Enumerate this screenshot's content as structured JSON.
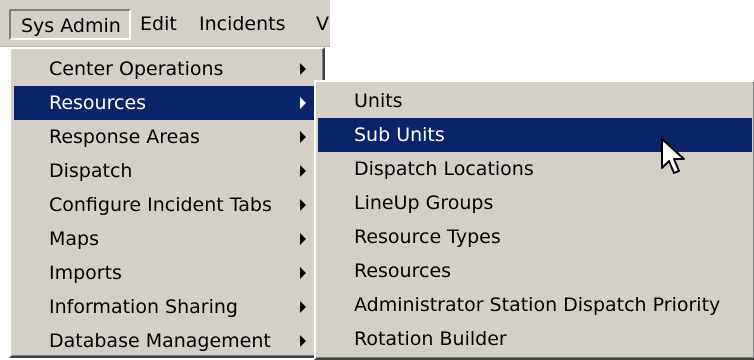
{
  "menubar": {
    "items": [
      "Sys Admin",
      "Edit",
      "Incidents",
      "V"
    ]
  },
  "main_menu": {
    "items": [
      {
        "label": "Center Operations"
      },
      {
        "label": "Resources"
      },
      {
        "label": "Response Areas"
      },
      {
        "label": "Dispatch"
      },
      {
        "label": "Configure Incident Tabs"
      },
      {
        "label": "Maps"
      },
      {
        "label": "Imports"
      },
      {
        "label": "Information Sharing"
      },
      {
        "label": "Database Management"
      }
    ],
    "selected": "Resources"
  },
  "sub_menu": {
    "items": [
      {
        "label": "Units"
      },
      {
        "label": "Sub Units"
      },
      {
        "label": "Dispatch Locations"
      },
      {
        "label": "LineUp Groups"
      },
      {
        "label": "Resource Types"
      },
      {
        "label": "Resources"
      },
      {
        "label": "Administrator Station Dispatch Priority"
      },
      {
        "label": "Rotation Builder"
      }
    ],
    "selected": "Sub Units"
  },
  "colors": {
    "menu_background": "#d4d0c8",
    "highlight": "#0a246a",
    "highlight_text": "#ffffff"
  },
  "icons": {
    "submenu_arrow": "right-triangle",
    "cursor": "arrow-pointer"
  }
}
